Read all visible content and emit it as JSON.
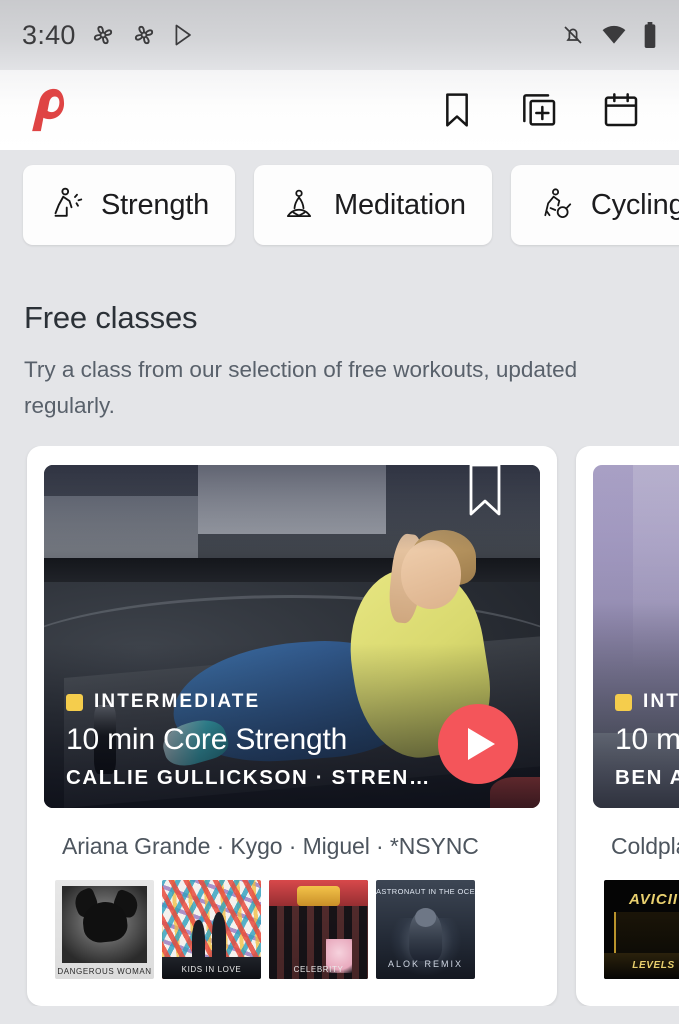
{
  "status_bar": {
    "time": "3:40",
    "left_icons": [
      "fan-icon",
      "fan-icon",
      "play-store-icon"
    ],
    "right_icons": [
      "notifications-off-icon",
      "wifi-icon",
      "battery-icon"
    ]
  },
  "app_bar": {
    "logo": "peloton-logo",
    "logo_color": "#DF4444",
    "actions": [
      {
        "name": "bookmark-icon",
        "label": "Saved classes"
      },
      {
        "name": "stack-add-icon",
        "label": "Add to stack"
      },
      {
        "name": "calendar-icon",
        "label": "Schedule"
      }
    ]
  },
  "chips": [
    {
      "icon": "strength-icon",
      "label": "Strength"
    },
    {
      "icon": "meditation-icon",
      "label": "Meditation"
    },
    {
      "icon": "cycling-icon",
      "label": "Cycling"
    }
  ],
  "section": {
    "title": "Free classes",
    "subtitle": "Try a class from our selection of free workouts, updated regularly."
  },
  "cards": [
    {
      "level": "INTERMEDIATE",
      "level_color": "#F5CD4C",
      "title": "10 min Core Strength",
      "subtitle": "CALLIE GULLICKSON  ·  STREN…",
      "play_button": "play-icon",
      "play_color": "#F4555A",
      "bookmark": "bookmark-icon",
      "artists": "Ariana Grande  ·  Kygo  ·  Miguel  ·  *NSYNC",
      "albums": [
        {
          "name": "album-dangerous-woman",
          "caption": "DANGEROUS WOMAN"
        },
        {
          "name": "album-kids-in-love",
          "caption": "KIDS IN LOVE"
        },
        {
          "name": "album-celebrity",
          "caption": "CELEBRITY"
        },
        {
          "name": "album-astronaut-in-the-ocean",
          "top_text": "ASTRONAUT IN THE OCEAN",
          "caption": "ALOK  REMIX"
        }
      ]
    },
    {
      "level": "INTE",
      "level_color": "#F5CD4C",
      "title": "10 m",
      "subtitle": "BEN A",
      "artists": "Coldplay",
      "albums": [
        {
          "name": "album-levels",
          "brand": "AVICII",
          "caption": "LEVELS"
        }
      ]
    }
  ],
  "colors": {
    "page_background": "#E4E5E8",
    "card_background": "#FFFFFF",
    "text_primary": "#2B3137",
    "text_secondary": "#59616B"
  }
}
